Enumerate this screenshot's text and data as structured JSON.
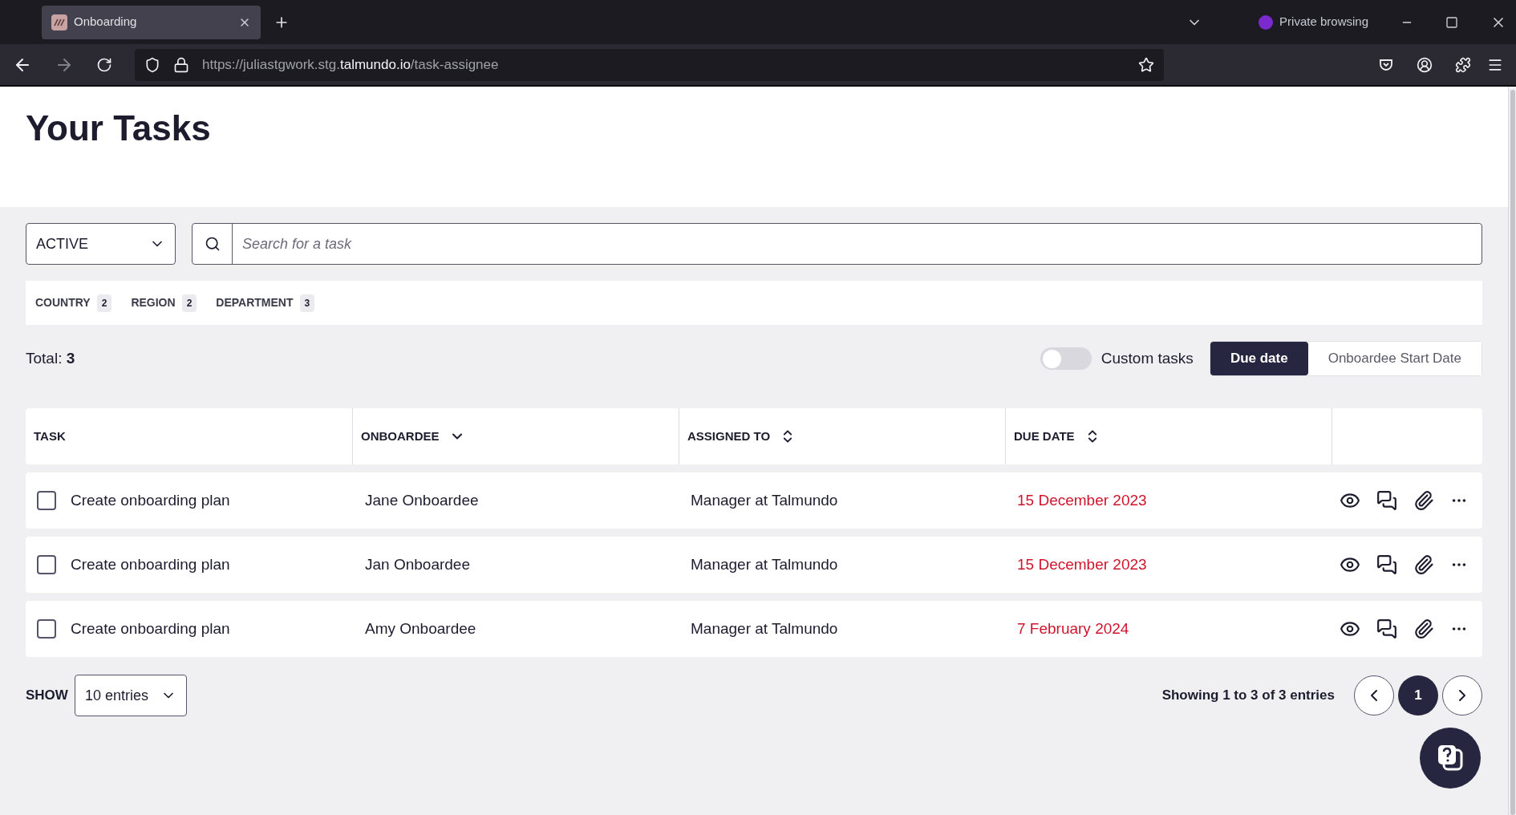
{
  "browser": {
    "tab": {
      "title": "Onboarding"
    },
    "private_label": "Private browsing",
    "url": {
      "prefix": "https://juliastgwork.stg.",
      "domain": "talmundo.io",
      "path": "/task-assignee"
    }
  },
  "page_title": "Your Tasks",
  "status_filter": {
    "value": "ACTIVE"
  },
  "search": {
    "placeholder": "Search for a task"
  },
  "filters": [
    {
      "label": "COUNTRY",
      "count": "2"
    },
    {
      "label": "REGION",
      "count": "2"
    },
    {
      "label": "DEPARTMENT",
      "count": "3"
    }
  ],
  "total": {
    "label": "Total:",
    "value": "3"
  },
  "custom_tasks": {
    "label": "Custom tasks",
    "on": false
  },
  "sort_tabs": [
    {
      "label": "Due date",
      "selected": true
    },
    {
      "label": "Onboardee Start Date",
      "selected": false
    }
  ],
  "table": {
    "columns": [
      {
        "label": "TASK",
        "kind": "plain"
      },
      {
        "label": "ONBOARDEE",
        "kind": "sorted"
      },
      {
        "label": "ASSIGNED TO",
        "kind": "sortable"
      },
      {
        "label": "DUE DATE",
        "kind": "sortable"
      }
    ],
    "rows": [
      {
        "checked": false,
        "task": "Create onboarding plan",
        "onboardee": "Jane Onboardee",
        "assigned_to": "Manager at Talmundo",
        "due_date": "15 December 2023",
        "overdue": true
      },
      {
        "checked": false,
        "task": "Create onboarding plan",
        "onboardee": "Jan Onboardee",
        "assigned_to": "Manager at Talmundo",
        "due_date": "15 December 2023",
        "overdue": true
      },
      {
        "checked": false,
        "task": "Create onboarding plan",
        "onboardee": "Amy Onboardee",
        "assigned_to": "Manager at Talmundo",
        "due_date": "7 February 2024",
        "overdue": true
      }
    ]
  },
  "show": {
    "label": "SHOW",
    "value": "10 entries"
  },
  "pagination": {
    "summary": "Showing 1 to 3 of 3 entries",
    "pages": [
      {
        "label": "1",
        "selected": true
      }
    ]
  }
}
